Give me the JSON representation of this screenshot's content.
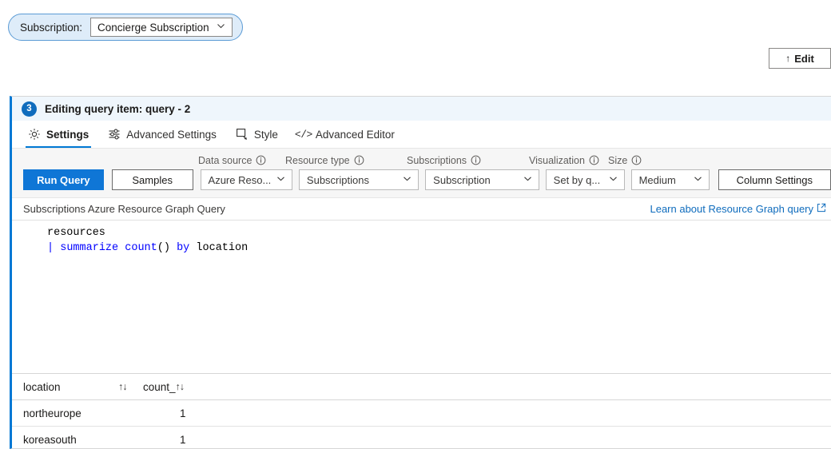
{
  "subscription_bar": {
    "label": "Subscription:",
    "selected": "Concierge Subscription",
    "chevron_icon": "chevron-down-icon"
  },
  "edit_button": {
    "label": "Edit",
    "icon": "pencil-icon",
    "glyph": "↑"
  },
  "panel": {
    "step_number": "3",
    "title": "Editing query item: query - 2",
    "accent_color": "#0078d4",
    "header_bg": "#eff6fc"
  },
  "tabs": [
    {
      "label": "Settings",
      "icon": "gear-icon",
      "active": true
    },
    {
      "label": "Advanced Settings",
      "icon": "sliders-icon",
      "active": false
    },
    {
      "label": "Style",
      "icon": "style-square-icon",
      "active": false
    },
    {
      "label": "Advanced Editor",
      "icon": "code-brackets-icon",
      "active": false
    }
  ],
  "toolbar": {
    "run_query_label": "Run Query",
    "samples_label": "Samples",
    "column_settings_label": "Column Settings",
    "fields": [
      {
        "label": "Data source",
        "value": "Azure Reso...",
        "info_icon": "info-icon",
        "chevron_icon": "chevron-down-icon"
      },
      {
        "label": "Resource type",
        "value": "Subscriptions",
        "info_icon": "info-icon",
        "chevron_icon": "chevron-down-icon"
      },
      {
        "label": "Subscriptions",
        "value": "Subscription",
        "info_icon": "info-icon",
        "chevron_icon": "chevron-down-icon"
      },
      {
        "label": "Visualization",
        "value": "Set by q...",
        "info_icon": "info-icon",
        "chevron_icon": "chevron-down-icon"
      },
      {
        "label": "Size",
        "value": "Medium",
        "info_icon": "info-icon",
        "chevron_icon": "chevron-down-icon"
      }
    ]
  },
  "query_section": {
    "caption": "Subscriptions Azure Resource Graph Query",
    "link_label": "Learn about Resource Graph query",
    "link_icon": "external-link-icon",
    "link_color": "#0f6cbd",
    "code": {
      "line1": "resources",
      "line2_pipe": "|",
      "line2_kw": "summarize",
      "line2_fn": "count",
      "line2_parens": "()",
      "line2_by": "by",
      "line2_id": "location"
    }
  },
  "results": {
    "columns": [
      {
        "label": "location",
        "sort_icon": "sort-arrows-icon",
        "sort_glyph": "↑↓"
      },
      {
        "label": "count_",
        "sort_icon": "sort-arrows-icon",
        "sort_glyph": "↑↓"
      }
    ],
    "rows": [
      {
        "location": "northeurope",
        "count": "1"
      },
      {
        "location": "koreasouth",
        "count": "1"
      }
    ]
  }
}
